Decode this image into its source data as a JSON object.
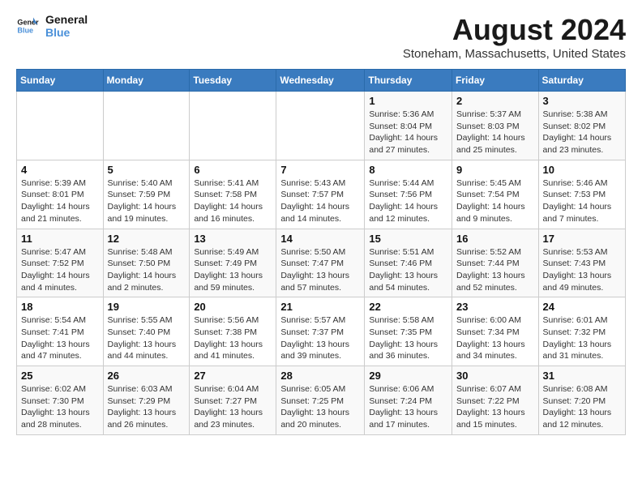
{
  "logo": {
    "line1": "General",
    "line2": "Blue"
  },
  "title": "August 2024",
  "location": "Stoneham, Massachusetts, United States",
  "weekdays": [
    "Sunday",
    "Monday",
    "Tuesday",
    "Wednesday",
    "Thursday",
    "Friday",
    "Saturday"
  ],
  "weeks": [
    [
      {
        "day": "",
        "info": ""
      },
      {
        "day": "",
        "info": ""
      },
      {
        "day": "",
        "info": ""
      },
      {
        "day": "",
        "info": ""
      },
      {
        "day": "1",
        "info": "Sunrise: 5:36 AM\nSunset: 8:04 PM\nDaylight: 14 hours\nand 27 minutes."
      },
      {
        "day": "2",
        "info": "Sunrise: 5:37 AM\nSunset: 8:03 PM\nDaylight: 14 hours\nand 25 minutes."
      },
      {
        "day": "3",
        "info": "Sunrise: 5:38 AM\nSunset: 8:02 PM\nDaylight: 14 hours\nand 23 minutes."
      }
    ],
    [
      {
        "day": "4",
        "info": "Sunrise: 5:39 AM\nSunset: 8:01 PM\nDaylight: 14 hours\nand 21 minutes."
      },
      {
        "day": "5",
        "info": "Sunrise: 5:40 AM\nSunset: 7:59 PM\nDaylight: 14 hours\nand 19 minutes."
      },
      {
        "day": "6",
        "info": "Sunrise: 5:41 AM\nSunset: 7:58 PM\nDaylight: 14 hours\nand 16 minutes."
      },
      {
        "day": "7",
        "info": "Sunrise: 5:43 AM\nSunset: 7:57 PM\nDaylight: 14 hours\nand 14 minutes."
      },
      {
        "day": "8",
        "info": "Sunrise: 5:44 AM\nSunset: 7:56 PM\nDaylight: 14 hours\nand 12 minutes."
      },
      {
        "day": "9",
        "info": "Sunrise: 5:45 AM\nSunset: 7:54 PM\nDaylight: 14 hours\nand 9 minutes."
      },
      {
        "day": "10",
        "info": "Sunrise: 5:46 AM\nSunset: 7:53 PM\nDaylight: 14 hours\nand 7 minutes."
      }
    ],
    [
      {
        "day": "11",
        "info": "Sunrise: 5:47 AM\nSunset: 7:52 PM\nDaylight: 14 hours\nand 4 minutes."
      },
      {
        "day": "12",
        "info": "Sunrise: 5:48 AM\nSunset: 7:50 PM\nDaylight: 14 hours\nand 2 minutes."
      },
      {
        "day": "13",
        "info": "Sunrise: 5:49 AM\nSunset: 7:49 PM\nDaylight: 13 hours\nand 59 minutes."
      },
      {
        "day": "14",
        "info": "Sunrise: 5:50 AM\nSunset: 7:47 PM\nDaylight: 13 hours\nand 57 minutes."
      },
      {
        "day": "15",
        "info": "Sunrise: 5:51 AM\nSunset: 7:46 PM\nDaylight: 13 hours\nand 54 minutes."
      },
      {
        "day": "16",
        "info": "Sunrise: 5:52 AM\nSunset: 7:44 PM\nDaylight: 13 hours\nand 52 minutes."
      },
      {
        "day": "17",
        "info": "Sunrise: 5:53 AM\nSunset: 7:43 PM\nDaylight: 13 hours\nand 49 minutes."
      }
    ],
    [
      {
        "day": "18",
        "info": "Sunrise: 5:54 AM\nSunset: 7:41 PM\nDaylight: 13 hours\nand 47 minutes."
      },
      {
        "day": "19",
        "info": "Sunrise: 5:55 AM\nSunset: 7:40 PM\nDaylight: 13 hours\nand 44 minutes."
      },
      {
        "day": "20",
        "info": "Sunrise: 5:56 AM\nSunset: 7:38 PM\nDaylight: 13 hours\nand 41 minutes."
      },
      {
        "day": "21",
        "info": "Sunrise: 5:57 AM\nSunset: 7:37 PM\nDaylight: 13 hours\nand 39 minutes."
      },
      {
        "day": "22",
        "info": "Sunrise: 5:58 AM\nSunset: 7:35 PM\nDaylight: 13 hours\nand 36 minutes."
      },
      {
        "day": "23",
        "info": "Sunrise: 6:00 AM\nSunset: 7:34 PM\nDaylight: 13 hours\nand 34 minutes."
      },
      {
        "day": "24",
        "info": "Sunrise: 6:01 AM\nSunset: 7:32 PM\nDaylight: 13 hours\nand 31 minutes."
      }
    ],
    [
      {
        "day": "25",
        "info": "Sunrise: 6:02 AM\nSunset: 7:30 PM\nDaylight: 13 hours\nand 28 minutes."
      },
      {
        "day": "26",
        "info": "Sunrise: 6:03 AM\nSunset: 7:29 PM\nDaylight: 13 hours\nand 26 minutes."
      },
      {
        "day": "27",
        "info": "Sunrise: 6:04 AM\nSunset: 7:27 PM\nDaylight: 13 hours\nand 23 minutes."
      },
      {
        "day": "28",
        "info": "Sunrise: 6:05 AM\nSunset: 7:25 PM\nDaylight: 13 hours\nand 20 minutes."
      },
      {
        "day": "29",
        "info": "Sunrise: 6:06 AM\nSunset: 7:24 PM\nDaylight: 13 hours\nand 17 minutes."
      },
      {
        "day": "30",
        "info": "Sunrise: 6:07 AM\nSunset: 7:22 PM\nDaylight: 13 hours\nand 15 minutes."
      },
      {
        "day": "31",
        "info": "Sunrise: 6:08 AM\nSunset: 7:20 PM\nDaylight: 13 hours\nand 12 minutes."
      }
    ]
  ]
}
